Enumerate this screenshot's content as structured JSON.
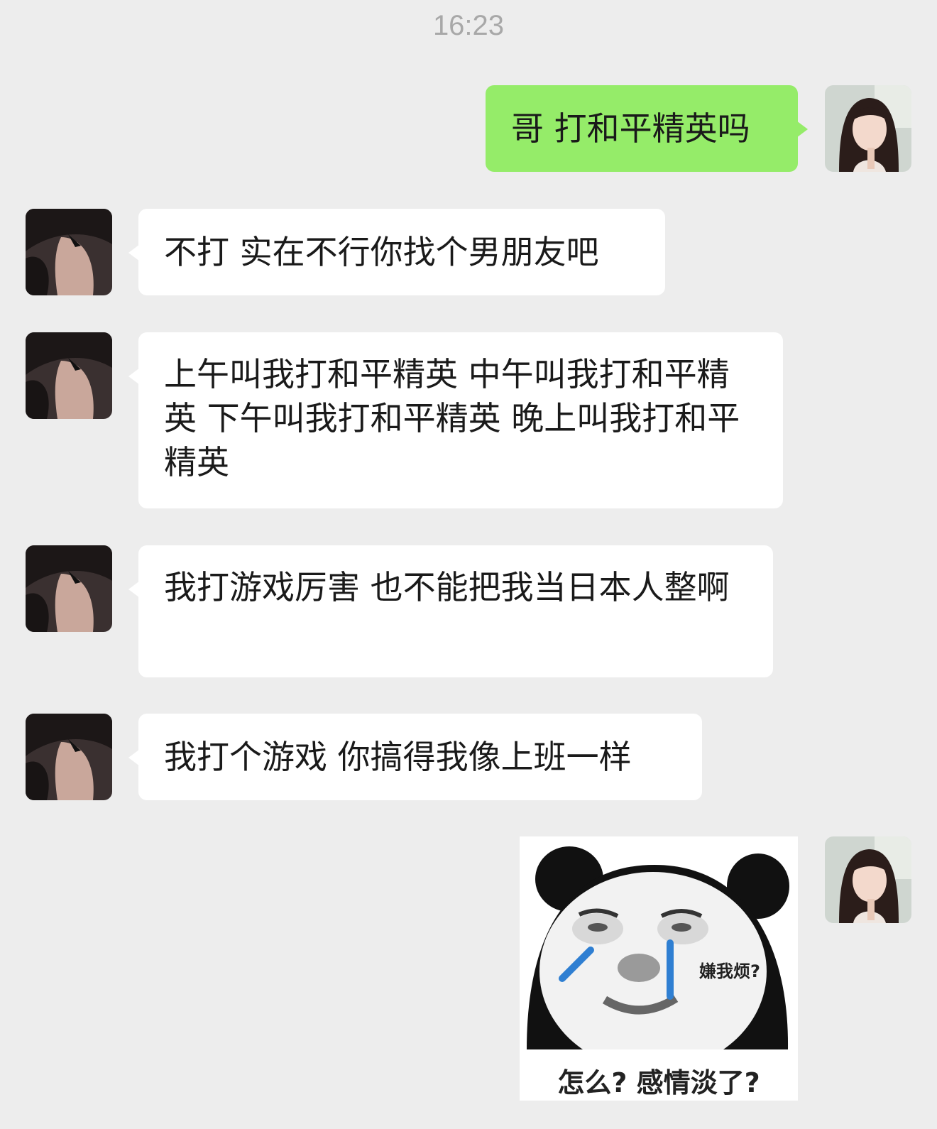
{
  "chat": {
    "timestamp": "16:23",
    "messages": [
      {
        "side": "sent",
        "type": "text",
        "text": "哥 打和平精英吗"
      },
      {
        "side": "received",
        "type": "text",
        "text": "不打 实在不行你找个男朋友吧"
      },
      {
        "side": "received",
        "type": "text",
        "text": "上午叫我打和平精英 中午叫我打和平精英 下午叫我打和平精英 晚上叫我打和平精英"
      },
      {
        "side": "received",
        "type": "text",
        "text": "我打游戏厉害 也不能把我当日本人整啊"
      },
      {
        "side": "received",
        "type": "text",
        "text": "我打个游戏 你搞得我像上班一样"
      },
      {
        "side": "sent",
        "type": "sticker",
        "icon": "panda-meme-sticker",
        "side_text": "嫌我烦?",
        "caption": "怎么? 感情淡了?"
      }
    ]
  },
  "colors": {
    "background": "#ededed",
    "sent_bubble": "#95ec69",
    "received_bubble": "#ffffff",
    "timestamp": "#a8a8a8"
  }
}
